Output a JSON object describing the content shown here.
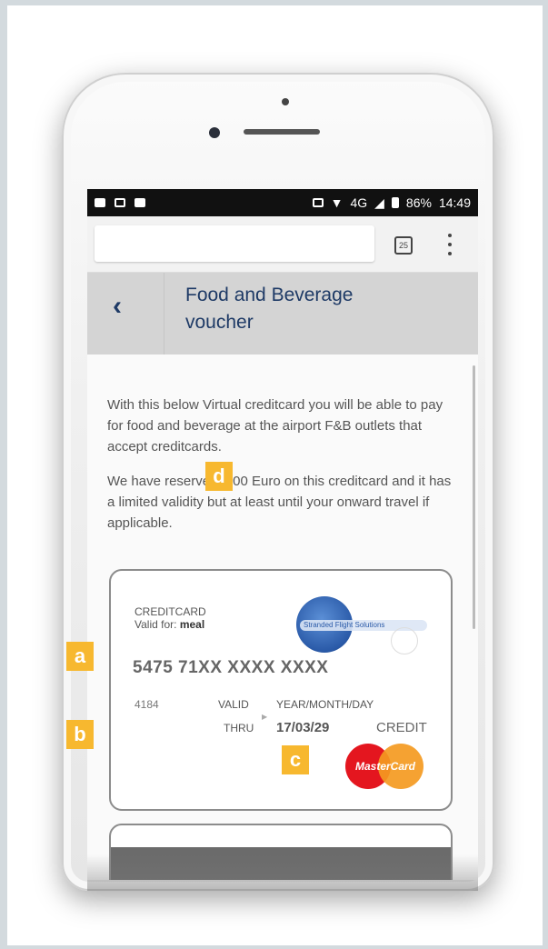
{
  "status_bar": {
    "network": "4G",
    "battery": "86%",
    "time": "14:49"
  },
  "browser": {
    "tab_count": "25"
  },
  "header": {
    "back_icon": "chevron-left-icon",
    "title": "Food and Beverage voucher"
  },
  "intro": {
    "paragraph1": "With this below Virtual creditcard you will be able to pay for food and beverage at the airport F&B outlets that accept creditcards.",
    "paragraph2": "We have reserved 5.00 Euro on this creditcard and it has a limited validity but at least until your onward travel if applicable."
  },
  "card": {
    "type_label": "CREDITCARD",
    "valid_for_label": "Valid for:",
    "valid_for_value": "meal",
    "issuer_logo_text": "Stranded Flight Solutions",
    "number": "5475 71XX XXXX XXXX",
    "cvc": "4184",
    "valid_label": "VALID",
    "thru_label": "THRU",
    "date_format": "YEAR/MONTH/DAY",
    "expiry": "17/03/29",
    "card_kind": "CREDIT",
    "brand": "MasterCard"
  },
  "markers": {
    "a": "a",
    "b": "b",
    "c": "c",
    "d": "d"
  },
  "colors": {
    "header_bg": "#d4d4d4",
    "title_color": "#1e3a66",
    "marker_color": "#f7b82f",
    "mastercard_red": "#e4161f",
    "mastercard_orange": "#f49a21"
  }
}
